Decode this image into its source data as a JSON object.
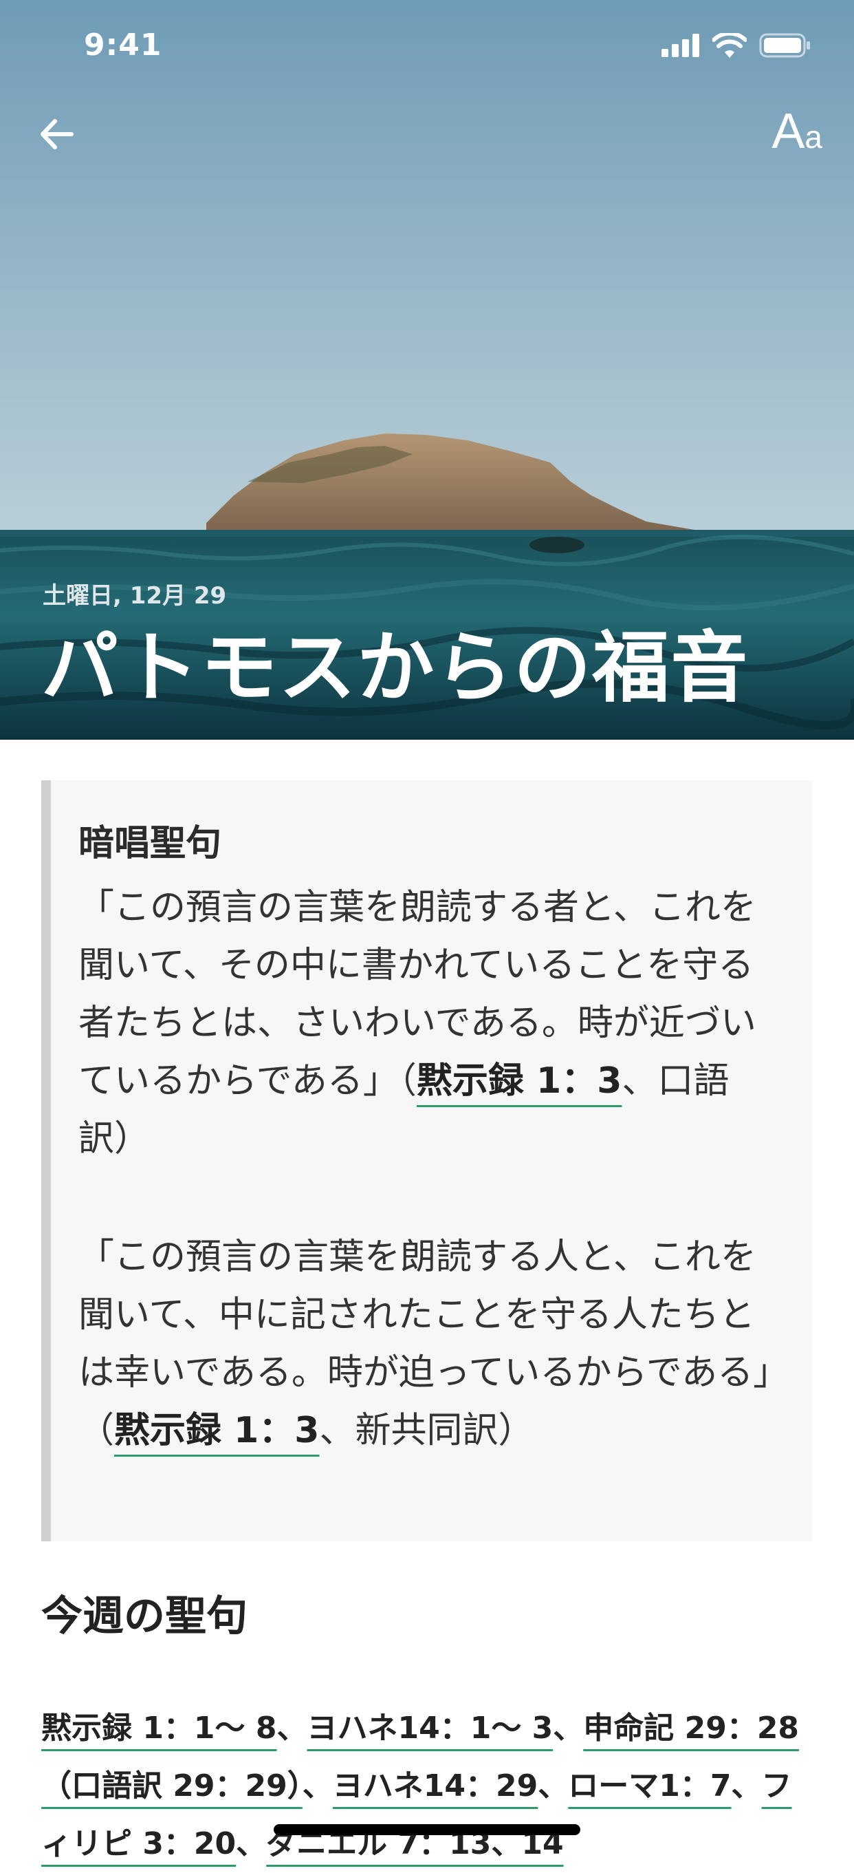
{
  "status_bar": {
    "time": "9:41"
  },
  "header": {
    "font_button_big": "A",
    "font_button_small": "a",
    "date": "土曜日, 12月 29",
    "title": "パトモスからの福音"
  },
  "memory_verse": {
    "heading": "暗唱聖句",
    "verse1_text": "「この預言の言葉を朗読する者と、これを聞いて、その中に書かれていることを守る者たちとは、さいわいである。時が近づいているからである」（",
    "verse1_ref": "黙示録 1：3",
    "verse1_tail": "、口語訳）",
    "verse2_text": "「この預言の言葉を朗読する人と、これを聞いて、中に記されたことを守る人たちとは幸いである。時が迫っているからである」（",
    "verse2_ref": "黙示録 1：3",
    "verse2_tail": "、新共同訳）"
  },
  "weekly": {
    "heading": "今週の聖句",
    "refs": [
      "黙示録 1：1〜 8",
      "ヨハネ14：1〜 3",
      "申命記 29：28（口語訳 29：29）",
      "ヨハネ14：29",
      "ローマ1：7",
      "フィリピ 3：20",
      "ダニエル 7：13、14"
    ],
    "separator": "、"
  },
  "colors": {
    "accent_underline": "#2e9b6b",
    "quote_bar": "#cfcfcf",
    "quote_bg": "#f7f7f7"
  },
  "icons": {
    "back": "arrow-left-icon",
    "font": "font-size-icon",
    "signal": "signal-icon",
    "wifi": "wifi-icon",
    "battery": "battery-icon"
  }
}
